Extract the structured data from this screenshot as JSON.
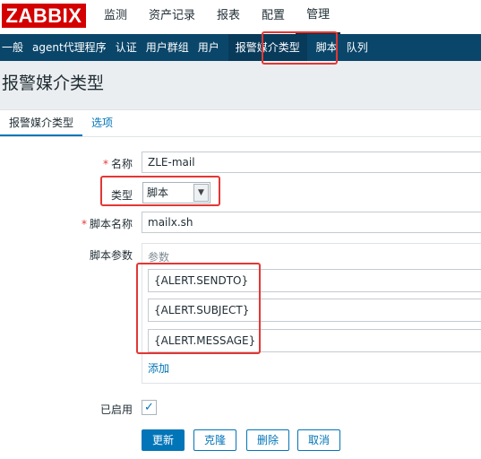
{
  "brand": {
    "logo": "ZABBIX"
  },
  "main_menu": [
    "监测",
    "资产记录",
    "报表",
    "配置",
    "管理"
  ],
  "main_menu_active": "管理",
  "sub_menu": [
    "一般",
    "agent代理程序",
    "认证",
    "用户群组",
    "用户",
    "报警媒介类型",
    "脚本",
    "队列"
  ],
  "sub_menu_active": "报警媒介类型",
  "page": {
    "title": "报警媒介类型"
  },
  "tabs": {
    "media_type": "报警媒介类型",
    "options": "选项"
  },
  "form": {
    "name_label": "名称",
    "name_value": "ZLE-mail",
    "type_label": "类型",
    "type_value": "脚本",
    "script_name_label": "脚本名称",
    "script_name_value": "mailx.sh",
    "script_params_label": "脚本参数",
    "params_header": "参数",
    "params": [
      "{ALERT.SENDTO}",
      "{ALERT.SUBJECT}",
      "{ALERT.MESSAGE}"
    ],
    "add_label": "添加",
    "enabled_label": "已启用",
    "enabled": true
  },
  "buttons": {
    "update": "更新",
    "clone": "克隆",
    "delete": "删除",
    "cancel": "取消"
  },
  "colors": {
    "brand_red": "#d40000",
    "nav_blue": "#0a466a",
    "accent": "#0275b8",
    "highlight": "#e33734"
  }
}
